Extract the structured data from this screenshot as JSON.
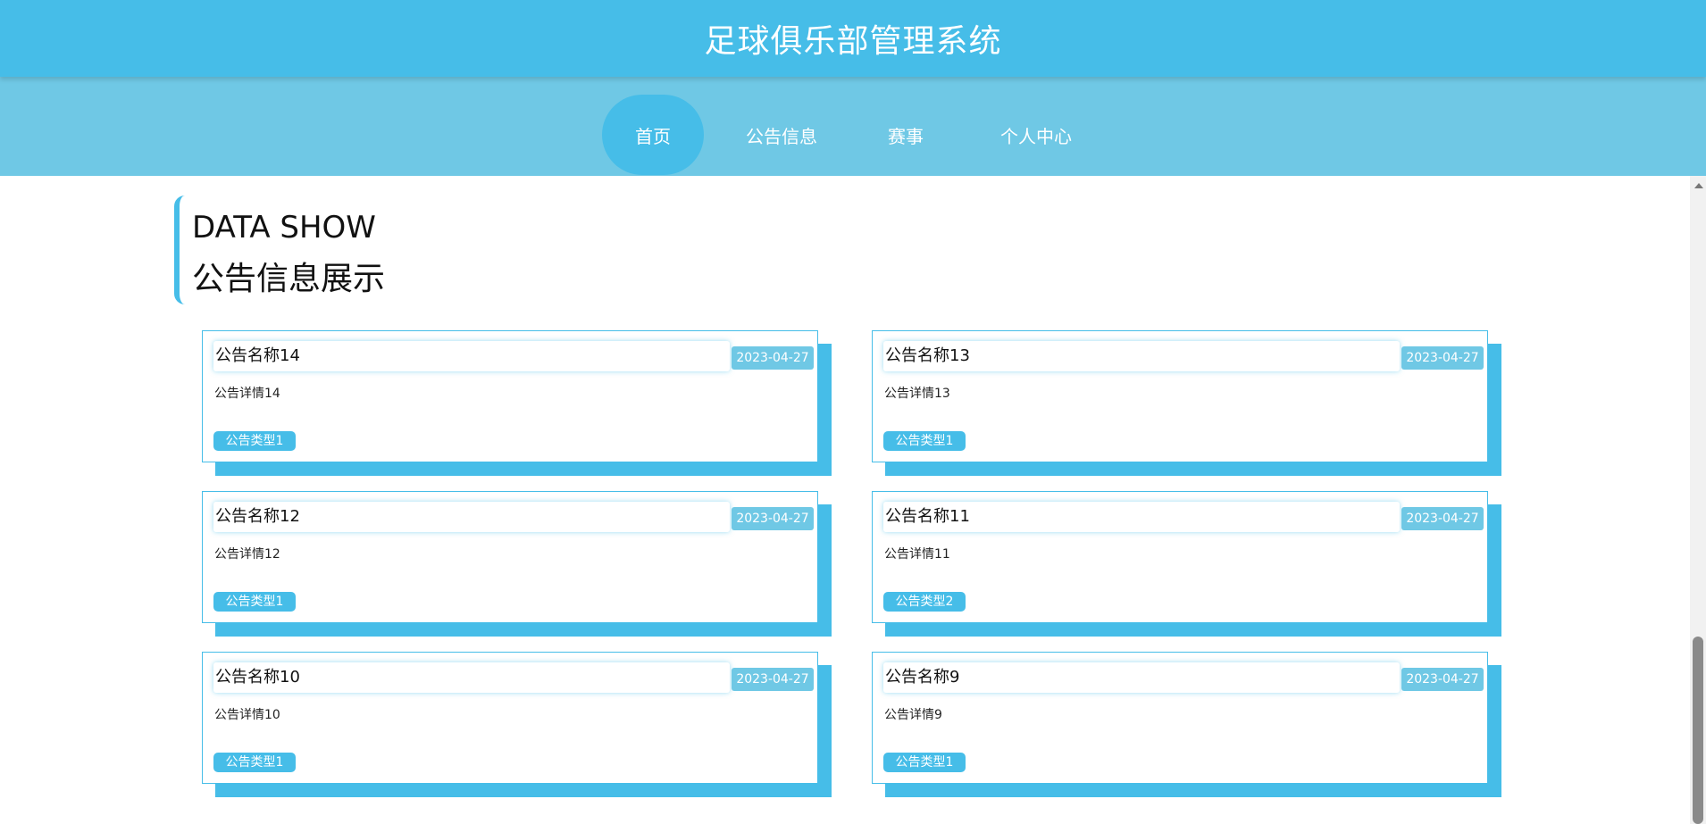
{
  "header": {
    "title": "足球俱乐部管理系统"
  },
  "nav": {
    "items": [
      {
        "label": "首页",
        "active": true
      },
      {
        "label": "公告信息",
        "active": false
      },
      {
        "label": "赛事",
        "active": false
      },
      {
        "label": "个人中心",
        "active": false
      }
    ]
  },
  "section": {
    "title_en": "DATA SHOW",
    "title_zh": "公告信息展示"
  },
  "notices": [
    {
      "name": "公告名称14",
      "date": "2023-04-27",
      "detail": "公告详情14",
      "type": "公告类型1"
    },
    {
      "name": "公告名称13",
      "date": "2023-04-27",
      "detail": "公告详情13",
      "type": "公告类型1"
    },
    {
      "name": "公告名称12",
      "date": "2023-04-27",
      "detail": "公告详情12",
      "type": "公告类型1"
    },
    {
      "name": "公告名称11",
      "date": "2023-04-27",
      "detail": "公告详情11",
      "type": "公告类型2"
    },
    {
      "name": "公告名称10",
      "date": "2023-04-27",
      "detail": "公告详情10",
      "type": "公告类型1"
    },
    {
      "name": "公告名称9",
      "date": "2023-04-27",
      "detail": "公告详情9",
      "type": "公告类型1"
    }
  ],
  "colors": {
    "primary": "#46bde8",
    "nav_background": "#6fc8e5",
    "date_badge": "#6fc8e5"
  }
}
